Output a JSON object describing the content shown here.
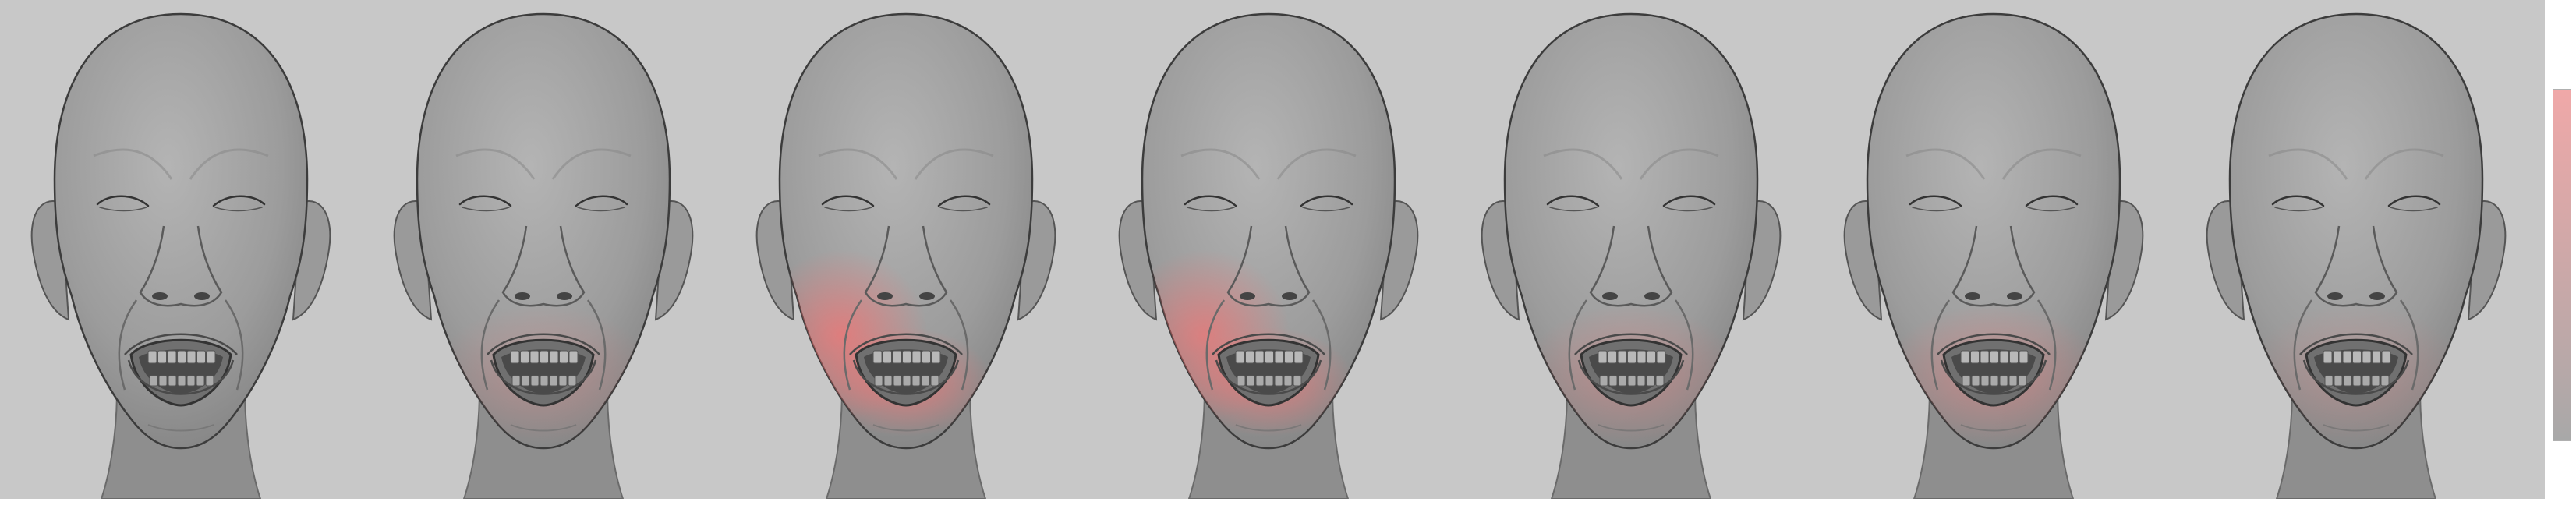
{
  "scene": {
    "background_color": "#c8c8c8",
    "skin_color": "#9a9a9a",
    "highlight_color": "#ff6e6e"
  },
  "faces": [
    {
      "id": "face-1",
      "highlight_intensity": 0.0,
      "highlight_focus": "none"
    },
    {
      "id": "face-2",
      "highlight_intensity": 0.35,
      "highlight_focus": "mouth-lower"
    },
    {
      "id": "face-3",
      "highlight_intensity": 0.9,
      "highlight_focus": "left-cheek-mouth"
    },
    {
      "id": "face-4",
      "highlight_intensity": 0.85,
      "highlight_focus": "left-cheek-mouth"
    },
    {
      "id": "face-5",
      "highlight_intensity": 0.45,
      "highlight_focus": "mouth-lower"
    },
    {
      "id": "face-6",
      "highlight_intensity": 0.55,
      "highlight_focus": "mouth-lower"
    },
    {
      "id": "face-7",
      "highlight_intensity": 0.3,
      "highlight_focus": "mouth-lower"
    }
  ],
  "colorbar": {
    "top_color": "#f0a8a8",
    "bottom_color": "#a8a8a8"
  }
}
